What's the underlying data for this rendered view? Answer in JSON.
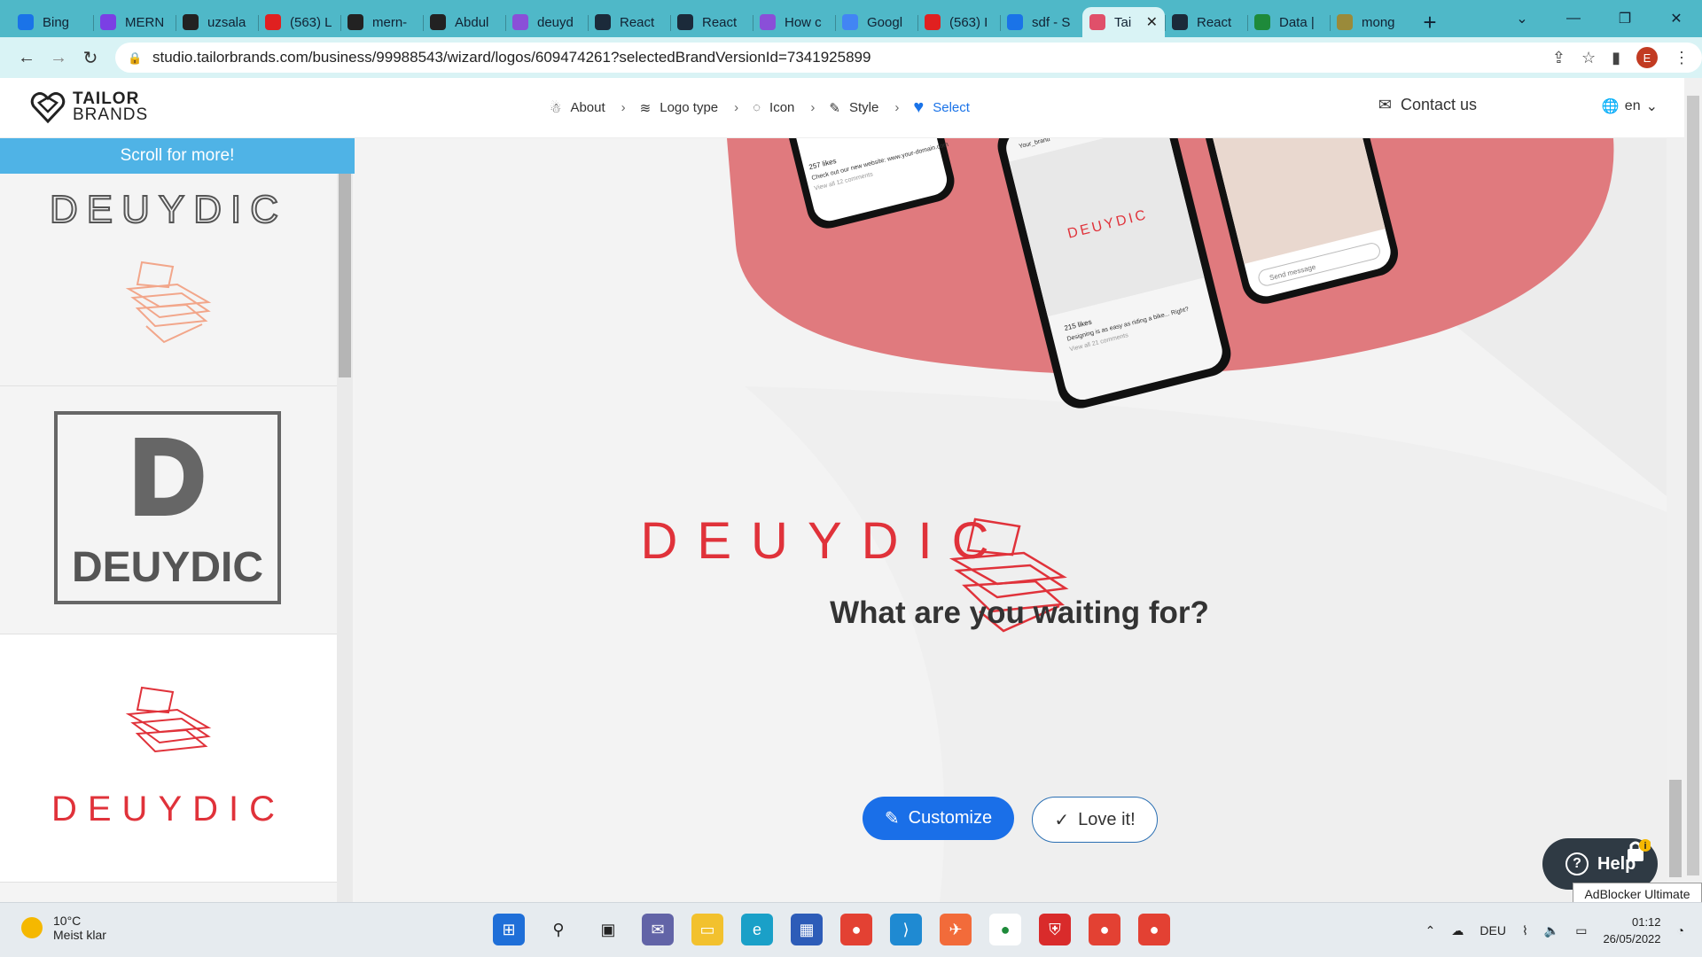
{
  "browser": {
    "tabs": [
      {
        "label": "Bing",
        "color": "#1a73e8"
      },
      {
        "label": "MERN",
        "color": "#7b3fe4"
      },
      {
        "label": "uzsala",
        "color": "#222"
      },
      {
        "label": "(563) L",
        "color": "#e02020"
      },
      {
        "label": "mern-",
        "color": "#222"
      },
      {
        "label": "Abdul",
        "color": "#222"
      },
      {
        "label": "deuyd",
        "color": "#8a4fd8"
      },
      {
        "label": "React",
        "color": "#1b2a3a"
      },
      {
        "label": "React",
        "color": "#1b2a3a"
      },
      {
        "label": "How c",
        "color": "#8a4fd8"
      },
      {
        "label": "Googl",
        "color": "#4285f4"
      },
      {
        "label": "(563) I",
        "color": "#e02020"
      },
      {
        "label": "sdf - S",
        "color": "#1a73e8"
      },
      {
        "label": "Tai",
        "color": "#e0506a",
        "active": true
      },
      {
        "label": "React",
        "color": "#1b2a3a"
      },
      {
        "label": "Data |",
        "color": "#1e8a3a"
      },
      {
        "label": "mong",
        "color": "#9a8a3a"
      }
    ],
    "url": "studio.tailorbrands.com/business/99988543/wizard/logos/609474261?selectedBrandVersionId=7341925899",
    "profile_initial": "E"
  },
  "site": {
    "brand_line1": "TAILOR",
    "brand_line2": "BRANDS",
    "steps": [
      "About",
      "Logo type",
      "Icon",
      "Style",
      "Select"
    ],
    "contact": "Contact us",
    "lang": "en"
  },
  "left_panel": {
    "scroll_banner": "Scroll for more!",
    "logos": [
      {
        "name": "DEUYDIC",
        "style": "outline"
      },
      {
        "name": "DEUYDIC",
        "initial": "D",
        "style": "boxed"
      },
      {
        "name": "DEUYDIC",
        "style": "stencil"
      }
    ]
  },
  "main": {
    "brand_name": "DEUYDIC",
    "headline": "What are you waiting for?",
    "customize": "Customize",
    "love": "Love it!",
    "accent": "#e0323a",
    "mockup": {
      "phone1_likes": "257 likes",
      "phone1_caption": "Check out our new website: www.your-domain.com",
      "phone1_comments": "View all 12 comments",
      "phone2_header": "Your_brand",
      "phone2_likes": "215 likes",
      "phone2_caption": "Designing is as easy as riding a bike... Right?",
      "phone2_comments": "View all 21 comments",
      "phone3_message": "Send message"
    }
  },
  "widgets": {
    "help": "Help",
    "adblock_tooltip": "AdBlocker Ultimate"
  },
  "taskbar": {
    "temperature": "10°C",
    "weather": "Meist klar",
    "lang": "DEU",
    "time": "01:12",
    "date": "26/05/2022"
  }
}
